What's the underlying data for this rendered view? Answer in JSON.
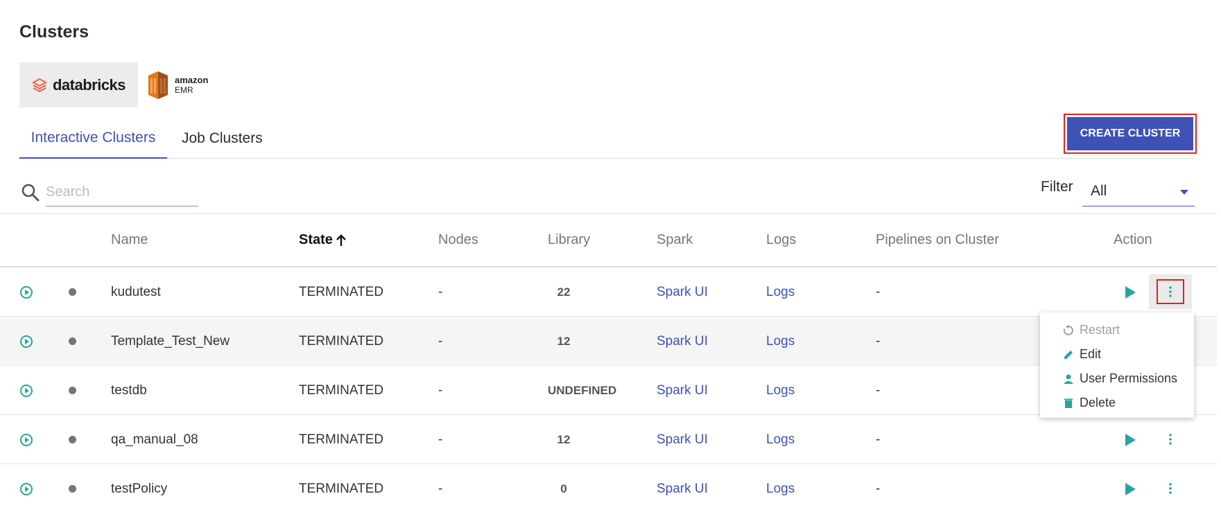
{
  "page": {
    "title": "Clusters"
  },
  "providers": {
    "databricks": "databricks",
    "emr_line1": "amazon",
    "emr_line2": "EMR"
  },
  "tabs": [
    {
      "label": "Interactive Clusters",
      "active": true
    },
    {
      "label": "Job Clusters",
      "active": false
    }
  ],
  "create_button": "CREATE CLUSTER",
  "search": {
    "placeholder": "Search",
    "value": ""
  },
  "filter": {
    "label": "Filter",
    "selected": "All"
  },
  "columns": {
    "name": "Name",
    "state": "State",
    "nodes": "Nodes",
    "library": "Library",
    "spark": "Spark",
    "logs": "Logs",
    "pipelines": "Pipelines on Cluster",
    "action": "Action"
  },
  "rows": [
    {
      "name": "kudutest",
      "state": "TERMINATED",
      "nodes": "-",
      "library": "22",
      "spark": "Spark UI",
      "logs": "Logs",
      "pipelines": "-"
    },
    {
      "name": "Template_Test_New",
      "state": "TERMINATED",
      "nodes": "-",
      "library": "12",
      "spark": "Spark UI",
      "logs": "Logs",
      "pipelines": "-"
    },
    {
      "name": "testdb",
      "state": "TERMINATED",
      "nodes": "-",
      "library": "UNDEFINED",
      "spark": "Spark UI",
      "logs": "Logs",
      "pipelines": "-"
    },
    {
      "name": "qa_manual_08",
      "state": "TERMINATED",
      "nodes": "-",
      "library": "12",
      "spark": "Spark UI",
      "logs": "Logs",
      "pipelines": "-"
    },
    {
      "name": "testPolicy",
      "state": "TERMINATED",
      "nodes": "-",
      "library": "0",
      "spark": "Spark UI",
      "logs": "Logs",
      "pipelines": "-"
    }
  ],
  "menu": {
    "restart": "Restart",
    "edit": "Edit",
    "permissions": "User Permissions",
    "delete": "Delete"
  },
  "colors": {
    "accent": "#3f51b5",
    "teal": "#26a69a",
    "highlight": "#e02020"
  }
}
